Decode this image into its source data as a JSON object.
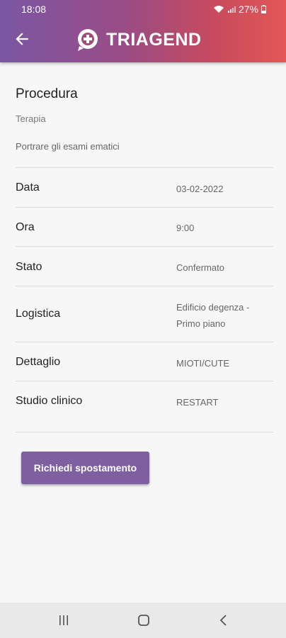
{
  "status_bar": {
    "time": "18:08",
    "battery": "27%"
  },
  "header": {
    "brand": "TRIAGEND",
    "colors": {
      "start": "#7a57a3",
      "end": "#e45757"
    }
  },
  "procedure": {
    "title": "Procedura",
    "subtitle": "Terapia",
    "description": "Portrare gli esami ematici"
  },
  "details": [
    {
      "label": "Data",
      "value": "03-02-2022"
    },
    {
      "label": "Ora",
      "value": "9:00"
    },
    {
      "label": "Stato",
      "value": "Confermato"
    },
    {
      "label": "Logistica",
      "value_line1": "Edificio degenza -",
      "value_line2": "Primo piano"
    },
    {
      "label": "Dettaglio",
      "value": "MIOTI/CUTE"
    },
    {
      "label": "Studio clinico",
      "value": "RESTART"
    }
  ],
  "action": {
    "label": "Richiedi spostamento",
    "color": "#7e60a1"
  },
  "navigation": {
    "icons": [
      "recent-apps-icon",
      "home-icon",
      "back-nav-icon"
    ]
  }
}
